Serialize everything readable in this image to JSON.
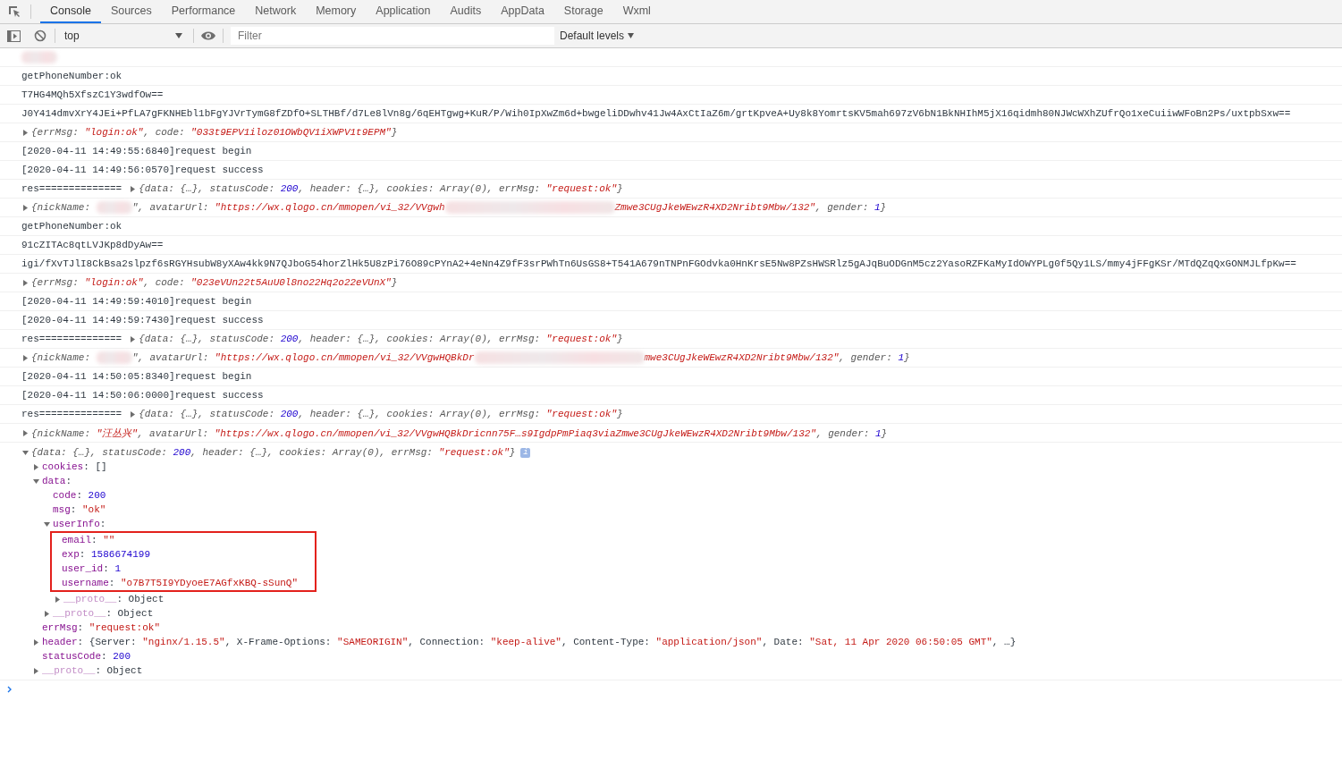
{
  "tabs": [
    {
      "label": "Console",
      "selected": true
    },
    {
      "label": "Sources",
      "selected": false
    },
    {
      "label": "Performance",
      "selected": false
    },
    {
      "label": "Network",
      "selected": false
    },
    {
      "label": "Memory",
      "selected": false
    },
    {
      "label": "Application",
      "selected": false
    },
    {
      "label": "Audits",
      "selected": false
    },
    {
      "label": "AppData",
      "selected": false
    },
    {
      "label": "Storage",
      "selected": false
    },
    {
      "label": "Wxml",
      "selected": false
    }
  ],
  "toolbar": {
    "context": "top",
    "filter": {
      "placeholder": "Filter"
    },
    "levels": "Default levels"
  },
  "log": [
    {
      "kind": "log",
      "segments": [
        {
          "kind": "redaction"
        }
      ]
    },
    {
      "kind": "log",
      "segments": [
        {
          "kind": "plain",
          "text": "getPhoneNumber:ok"
        }
      ]
    },
    {
      "kind": "log",
      "segments": [
        {
          "kind": "plain",
          "text": "T7HG4MQh5XfszC1Y3wdfOw=="
        }
      ]
    },
    {
      "kind": "log",
      "segments": [
        {
          "kind": "plain",
          "text": "J0Y414dmvXrY4JEi+PfLA7gFKNHEbl1bFgYJVrTymG8fZDfO+SLTHBf/d7Le8lVn8g/6qEHTgwg+KuR/P/Wih0IpXwZm6d+bwgeliDDwhv41Jw4AxCtIaZ6m/grtKpveA+Uy8k8YomrtsKV5mah697zV6bN1BkNHIhM5jX16qidmh80NJWcWXhZUfrQo1xeCuiiwWFoBn2Ps/uxtpbSxw=="
        }
      ]
    },
    {
      "kind": "object",
      "expanded": false,
      "segments": [
        {
          "kind": "plain",
          "text": "{"
        },
        {
          "kind": "key",
          "text": "errMsg"
        },
        {
          "kind": "plain",
          "text": ": "
        },
        {
          "kind": "string",
          "text": "\"login:ok\""
        },
        {
          "kind": "plain",
          "text": ", "
        },
        {
          "kind": "key",
          "text": "code"
        },
        {
          "kind": "plain",
          "text": ": "
        },
        {
          "kind": "string",
          "text": "\"033t9EPV1iloz01OWbQV1iXWPV1t9EPM\""
        },
        {
          "kind": "plain",
          "text": "}"
        }
      ]
    },
    {
      "kind": "log",
      "segments": [
        {
          "kind": "plain",
          "text": "[2020-04-11 14:49:55:6840]request begin"
        }
      ]
    },
    {
      "kind": "log",
      "segments": [
        {
          "kind": "plain",
          "text": "[2020-04-11 14:49:56:0570]request success"
        }
      ]
    },
    {
      "kind": "res",
      "prefix": "res==============",
      "expanded": false,
      "segments": [
        {
          "kind": "plain",
          "text": "{"
        },
        {
          "kind": "key",
          "text": "data"
        },
        {
          "kind": "plain",
          "text": ": {…}, "
        },
        {
          "kind": "key",
          "text": "statusCode"
        },
        {
          "kind": "plain",
          "text": ": "
        },
        {
          "kind": "number",
          "text": "200"
        },
        {
          "kind": "plain",
          "text": ", "
        },
        {
          "kind": "key",
          "text": "header"
        },
        {
          "kind": "plain",
          "text": ": {…}, "
        },
        {
          "kind": "key",
          "text": "cookies"
        },
        {
          "kind": "plain",
          "text": ": Array(0), "
        },
        {
          "kind": "key",
          "text": "errMsg"
        },
        {
          "kind": "plain",
          "text": ": "
        },
        {
          "kind": "string",
          "text": "\"request:ok\""
        },
        {
          "kind": "plain",
          "text": "}"
        }
      ]
    },
    {
      "kind": "object",
      "expanded": false,
      "segments": [
        {
          "kind": "plain",
          "text": "{"
        },
        {
          "kind": "key",
          "text": "nickName"
        },
        {
          "kind": "plain",
          "text": ": "
        },
        {
          "kind": "redaction"
        },
        {
          "kind": "plain",
          "text": "\", "
        },
        {
          "kind": "key",
          "text": "avatarUrl"
        },
        {
          "kind": "plain",
          "text": ": "
        },
        {
          "kind": "string",
          "text": "\"https://wx.qlogo.cn/mmopen/vi_32/VVgwh"
        },
        {
          "kind": "long_redaction"
        },
        {
          "kind": "string",
          "text": "Zmwe3CUgJkeWEwzR4XD2Nribt9Mbw/132\""
        },
        {
          "kind": "plain",
          "text": ", "
        },
        {
          "kind": "key",
          "text": "gender"
        },
        {
          "kind": "plain",
          "text": ": "
        },
        {
          "kind": "number",
          "text": "1"
        },
        {
          "kind": "plain",
          "text": "}"
        }
      ]
    },
    {
      "kind": "log",
      "segments": [
        {
          "kind": "plain",
          "text": "getPhoneNumber:ok"
        }
      ]
    },
    {
      "kind": "log",
      "segments": [
        {
          "kind": "plain",
          "text": "91cZITAc8qtLVJKp8dDyAw=="
        }
      ]
    },
    {
      "kind": "log",
      "segments": [
        {
          "kind": "plain",
          "text": "igi/fXvTJlI8CkBsa2slpzf6sRGYHsubW8yXAw4kk9N7QJboG54horZlHk5U8zPi76O89cPYnA2+4eNn4Z9fF3srPWhTn6UsGS8+T541A679nTNPnFGOdvka0HnKrsE5Nw8PZsHWSRlz5gAJqBuODGnM5cz2YasoRZFKaMyIdOWYPLg0f5Qy1LS/mmy4jFFgKSr/MTdQZqQxGONMJLfpKw=="
        }
      ]
    },
    {
      "kind": "object",
      "expanded": false,
      "segments": [
        {
          "kind": "plain",
          "text": "{"
        },
        {
          "kind": "key",
          "text": "errMsg"
        },
        {
          "kind": "plain",
          "text": ": "
        },
        {
          "kind": "string",
          "text": "\"login:ok\""
        },
        {
          "kind": "plain",
          "text": ", "
        },
        {
          "kind": "key",
          "text": "code"
        },
        {
          "kind": "plain",
          "text": ": "
        },
        {
          "kind": "string",
          "text": "\"023eVUn22t5AuU0l8no22Hq2o22eVUnX\""
        },
        {
          "kind": "plain",
          "text": "}"
        }
      ]
    },
    {
      "kind": "log",
      "segments": [
        {
          "kind": "plain",
          "text": "[2020-04-11 14:49:59:4010]request begin"
        }
      ]
    },
    {
      "kind": "log",
      "segments": [
        {
          "kind": "plain",
          "text": "[2020-04-11 14:49:59:7430]request success"
        }
      ]
    },
    {
      "kind": "res",
      "prefix": "res==============",
      "expanded": false,
      "segments": [
        {
          "kind": "plain",
          "text": "{"
        },
        {
          "kind": "key",
          "text": "data"
        },
        {
          "kind": "plain",
          "text": ": {…}, "
        },
        {
          "kind": "key",
          "text": "statusCode"
        },
        {
          "kind": "plain",
          "text": ": "
        },
        {
          "kind": "number",
          "text": "200"
        },
        {
          "kind": "plain",
          "text": ", "
        },
        {
          "kind": "key",
          "text": "header"
        },
        {
          "kind": "plain",
          "text": ": {…}, "
        },
        {
          "kind": "key",
          "text": "cookies"
        },
        {
          "kind": "plain",
          "text": ": Array(0), "
        },
        {
          "kind": "key",
          "text": "errMsg"
        },
        {
          "kind": "plain",
          "text": ": "
        },
        {
          "kind": "string",
          "text": "\"request:ok\""
        },
        {
          "kind": "plain",
          "text": "}"
        }
      ]
    },
    {
      "kind": "object",
      "expanded": false,
      "segments": [
        {
          "kind": "plain",
          "text": "{"
        },
        {
          "kind": "key",
          "text": "nickName"
        },
        {
          "kind": "plain",
          "text": ": "
        },
        {
          "kind": "redaction"
        },
        {
          "kind": "plain",
          "text": "\", "
        },
        {
          "kind": "key",
          "text": "avatarUrl"
        },
        {
          "kind": "plain",
          "text": ": "
        },
        {
          "kind": "string",
          "text": "\"https://wx.qlogo.cn/mmopen/vi_32/VVgwHQBkDr"
        },
        {
          "kind": "long_redaction"
        },
        {
          "kind": "string",
          "text": "mwe3CUgJkeWEwzR4XD2Nribt9Mbw/132\""
        },
        {
          "kind": "plain",
          "text": ", "
        },
        {
          "kind": "key",
          "text": "gender"
        },
        {
          "kind": "plain",
          "text": ": "
        },
        {
          "kind": "number",
          "text": "1"
        },
        {
          "kind": "plain",
          "text": "}"
        }
      ]
    },
    {
      "kind": "log",
      "segments": [
        {
          "kind": "plain",
          "text": "[2020-04-11 14:50:05:8340]request begin"
        }
      ]
    },
    {
      "kind": "log",
      "segments": [
        {
          "kind": "plain",
          "text": "[2020-04-11 14:50:06:0000]request success"
        }
      ]
    },
    {
      "kind": "res",
      "prefix": "res==============",
      "expanded": false,
      "segments": [
        {
          "kind": "plain",
          "text": "{"
        },
        {
          "kind": "key",
          "text": "data"
        },
        {
          "kind": "plain",
          "text": ": {…}, "
        },
        {
          "kind": "key",
          "text": "statusCode"
        },
        {
          "kind": "plain",
          "text": ": "
        },
        {
          "kind": "number",
          "text": "200"
        },
        {
          "kind": "plain",
          "text": ", "
        },
        {
          "kind": "key",
          "text": "header"
        },
        {
          "kind": "plain",
          "text": ": {…}, "
        },
        {
          "kind": "key",
          "text": "cookies"
        },
        {
          "kind": "plain",
          "text": ": Array(0), "
        },
        {
          "kind": "key",
          "text": "errMsg"
        },
        {
          "kind": "plain",
          "text": ": "
        },
        {
          "kind": "string",
          "text": "\"request:ok\""
        },
        {
          "kind": "plain",
          "text": "}"
        }
      ]
    },
    {
      "kind": "object",
      "expanded": false,
      "segments": [
        {
          "kind": "plain",
          "text": "{"
        },
        {
          "kind": "key",
          "text": "nickName"
        },
        {
          "kind": "plain",
          "text": ": "
        },
        {
          "kind": "string",
          "text": "\"汪丛兴\""
        },
        {
          "kind": "plain",
          "text": ", "
        },
        {
          "kind": "key",
          "text": "avatarUrl"
        },
        {
          "kind": "plain",
          "text": ": "
        },
        {
          "kind": "string",
          "text": "\"https://wx.qlogo.cn/mmopen/vi_32/VVgwHQBkDricnn75F…s9IgdpPmPiaq3viaZmwe3CUgJkeWEwzR4XD2Nribt9Mbw/132\""
        },
        {
          "kind": "plain",
          "text": ", "
        },
        {
          "kind": "key",
          "text": "gender"
        },
        {
          "kind": "plain",
          "text": ": "
        },
        {
          "kind": "number",
          "text": "1"
        },
        {
          "kind": "plain",
          "text": "}"
        }
      ]
    },
    {
      "kind": "object",
      "expanded": true,
      "badge": "i",
      "segments": [
        {
          "kind": "plain",
          "text": "{"
        },
        {
          "kind": "key",
          "text": "data"
        },
        {
          "kind": "plain",
          "text": ": {…}, "
        },
        {
          "kind": "key",
          "text": "statusCode"
        },
        {
          "kind": "plain",
          "text": ": "
        },
        {
          "kind": "number",
          "text": "200"
        },
        {
          "kind": "plain",
          "text": ", "
        },
        {
          "kind": "key",
          "text": "header"
        },
        {
          "kind": "plain",
          "text": ": {…}, "
        },
        {
          "kind": "key",
          "text": "cookies"
        },
        {
          "kind": "plain",
          "text": ": Array(0), "
        },
        {
          "kind": "key",
          "text": "errMsg"
        },
        {
          "kind": "plain",
          "text": ": "
        },
        {
          "kind": "string",
          "text": "\"request:ok\""
        },
        {
          "kind": "plain",
          "text": "}"
        }
      ],
      "children": [
        {
          "key": "cookies",
          "kind": "own",
          "expandable": true,
          "expanded": false,
          "value": [
            {
              "kind": "plain",
              "text": ": []"
            }
          ]
        },
        {
          "key": "data",
          "kind": "own",
          "expandable": true,
          "expanded": true,
          "value": [
            {
              "kind": "plain",
              "text": ":"
            }
          ],
          "children": [
            {
              "key": "code",
              "kind": "own",
              "expandable": false,
              "value": [
                {
                  "kind": "plain",
                  "text": ": "
                },
                {
                  "kind": "number",
                  "text": "200"
                }
              ]
            },
            {
              "key": "msg",
              "kind": "own",
              "expandable": false,
              "value": [
                {
                  "kind": "plain",
                  "text": ": "
                },
                {
                  "kind": "string",
                  "text": "\"ok\""
                }
              ]
            },
            {
              "key": "userInfo",
              "kind": "own",
              "expandable": true,
              "expanded": true,
              "value": [
                {
                  "kind": "plain",
                  "text": ":"
                }
              ],
              "children": [
                {
                  "key": "email",
                  "kind": "own",
                  "expandable": false,
                  "boxed": true,
                  "value": [
                    {
                      "kind": "plain",
                      "text": ": "
                    },
                    {
                      "kind": "string",
                      "text": "\"\""
                    }
                  ]
                },
                {
                  "key": "exp",
                  "kind": "own",
                  "expandable": false,
                  "boxed": true,
                  "value": [
                    {
                      "kind": "plain",
                      "text": ": "
                    },
                    {
                      "kind": "number",
                      "text": "1586674199"
                    }
                  ]
                },
                {
                  "key": "user_id",
                  "kind": "own",
                  "expandable": false,
                  "boxed": true,
                  "value": [
                    {
                      "kind": "plain",
                      "text": ": "
                    },
                    {
                      "kind": "number",
                      "text": "1"
                    }
                  ]
                },
                {
                  "key": "username",
                  "kind": "own",
                  "expandable": false,
                  "boxed": true,
                  "value": [
                    {
                      "kind": "plain",
                      "text": ": "
                    },
                    {
                      "kind": "string",
                      "text": "\"o7B7T5I9YDyoeE7AGfxKBQ-sSunQ\""
                    }
                  ]
                },
                {
                  "key": "__proto__",
                  "kind": "proto",
                  "expandable": true,
                  "expanded": false,
                  "boxed": false,
                  "value": [
                    {
                      "kind": "plain",
                      "text": ": Object"
                    }
                  ]
                }
              ]
            },
            {
              "key": "__proto__",
              "kind": "proto",
              "expandable": true,
              "expanded": false,
              "value": [
                {
                  "kind": "plain",
                  "text": ": Object"
                }
              ]
            }
          ]
        },
        {
          "key": "errMsg",
          "kind": "own",
          "expandable": false,
          "value": [
            {
              "kind": "plain",
              "text": ": "
            },
            {
              "kind": "string",
              "text": "\"request:ok\""
            }
          ]
        },
        {
          "key": "header",
          "kind": "own",
          "expandable": true,
          "expanded": false,
          "value": [
            {
              "kind": "plain",
              "text": ": {Server: "
            },
            {
              "kind": "string",
              "text": "\"nginx/1.15.5\""
            },
            {
              "kind": "plain",
              "text": ", X-Frame-Options: "
            },
            {
              "kind": "string",
              "text": "\"SAMEORIGIN\""
            },
            {
              "kind": "plain",
              "text": ", Connection: "
            },
            {
              "kind": "string",
              "text": "\"keep-alive\""
            },
            {
              "kind": "plain",
              "text": ", Content-Type: "
            },
            {
              "kind": "string",
              "text": "\"application/json\""
            },
            {
              "kind": "plain",
              "text": ", Date: "
            },
            {
              "kind": "string",
              "text": "\"Sat, 11 Apr 2020 06:50:05 GMT\""
            },
            {
              "kind": "plain",
              "text": ", …}"
            }
          ]
        },
        {
          "key": "statusCode",
          "kind": "own",
          "expandable": false,
          "value": [
            {
              "kind": "plain",
              "text": ": "
            },
            {
              "kind": "number",
              "text": "200"
            }
          ]
        },
        {
          "key": "__proto__",
          "kind": "proto",
          "expandable": true,
          "expanded": false,
          "value": [
            {
              "kind": "plain",
              "text": ": Object"
            }
          ]
        }
      ]
    }
  ]
}
